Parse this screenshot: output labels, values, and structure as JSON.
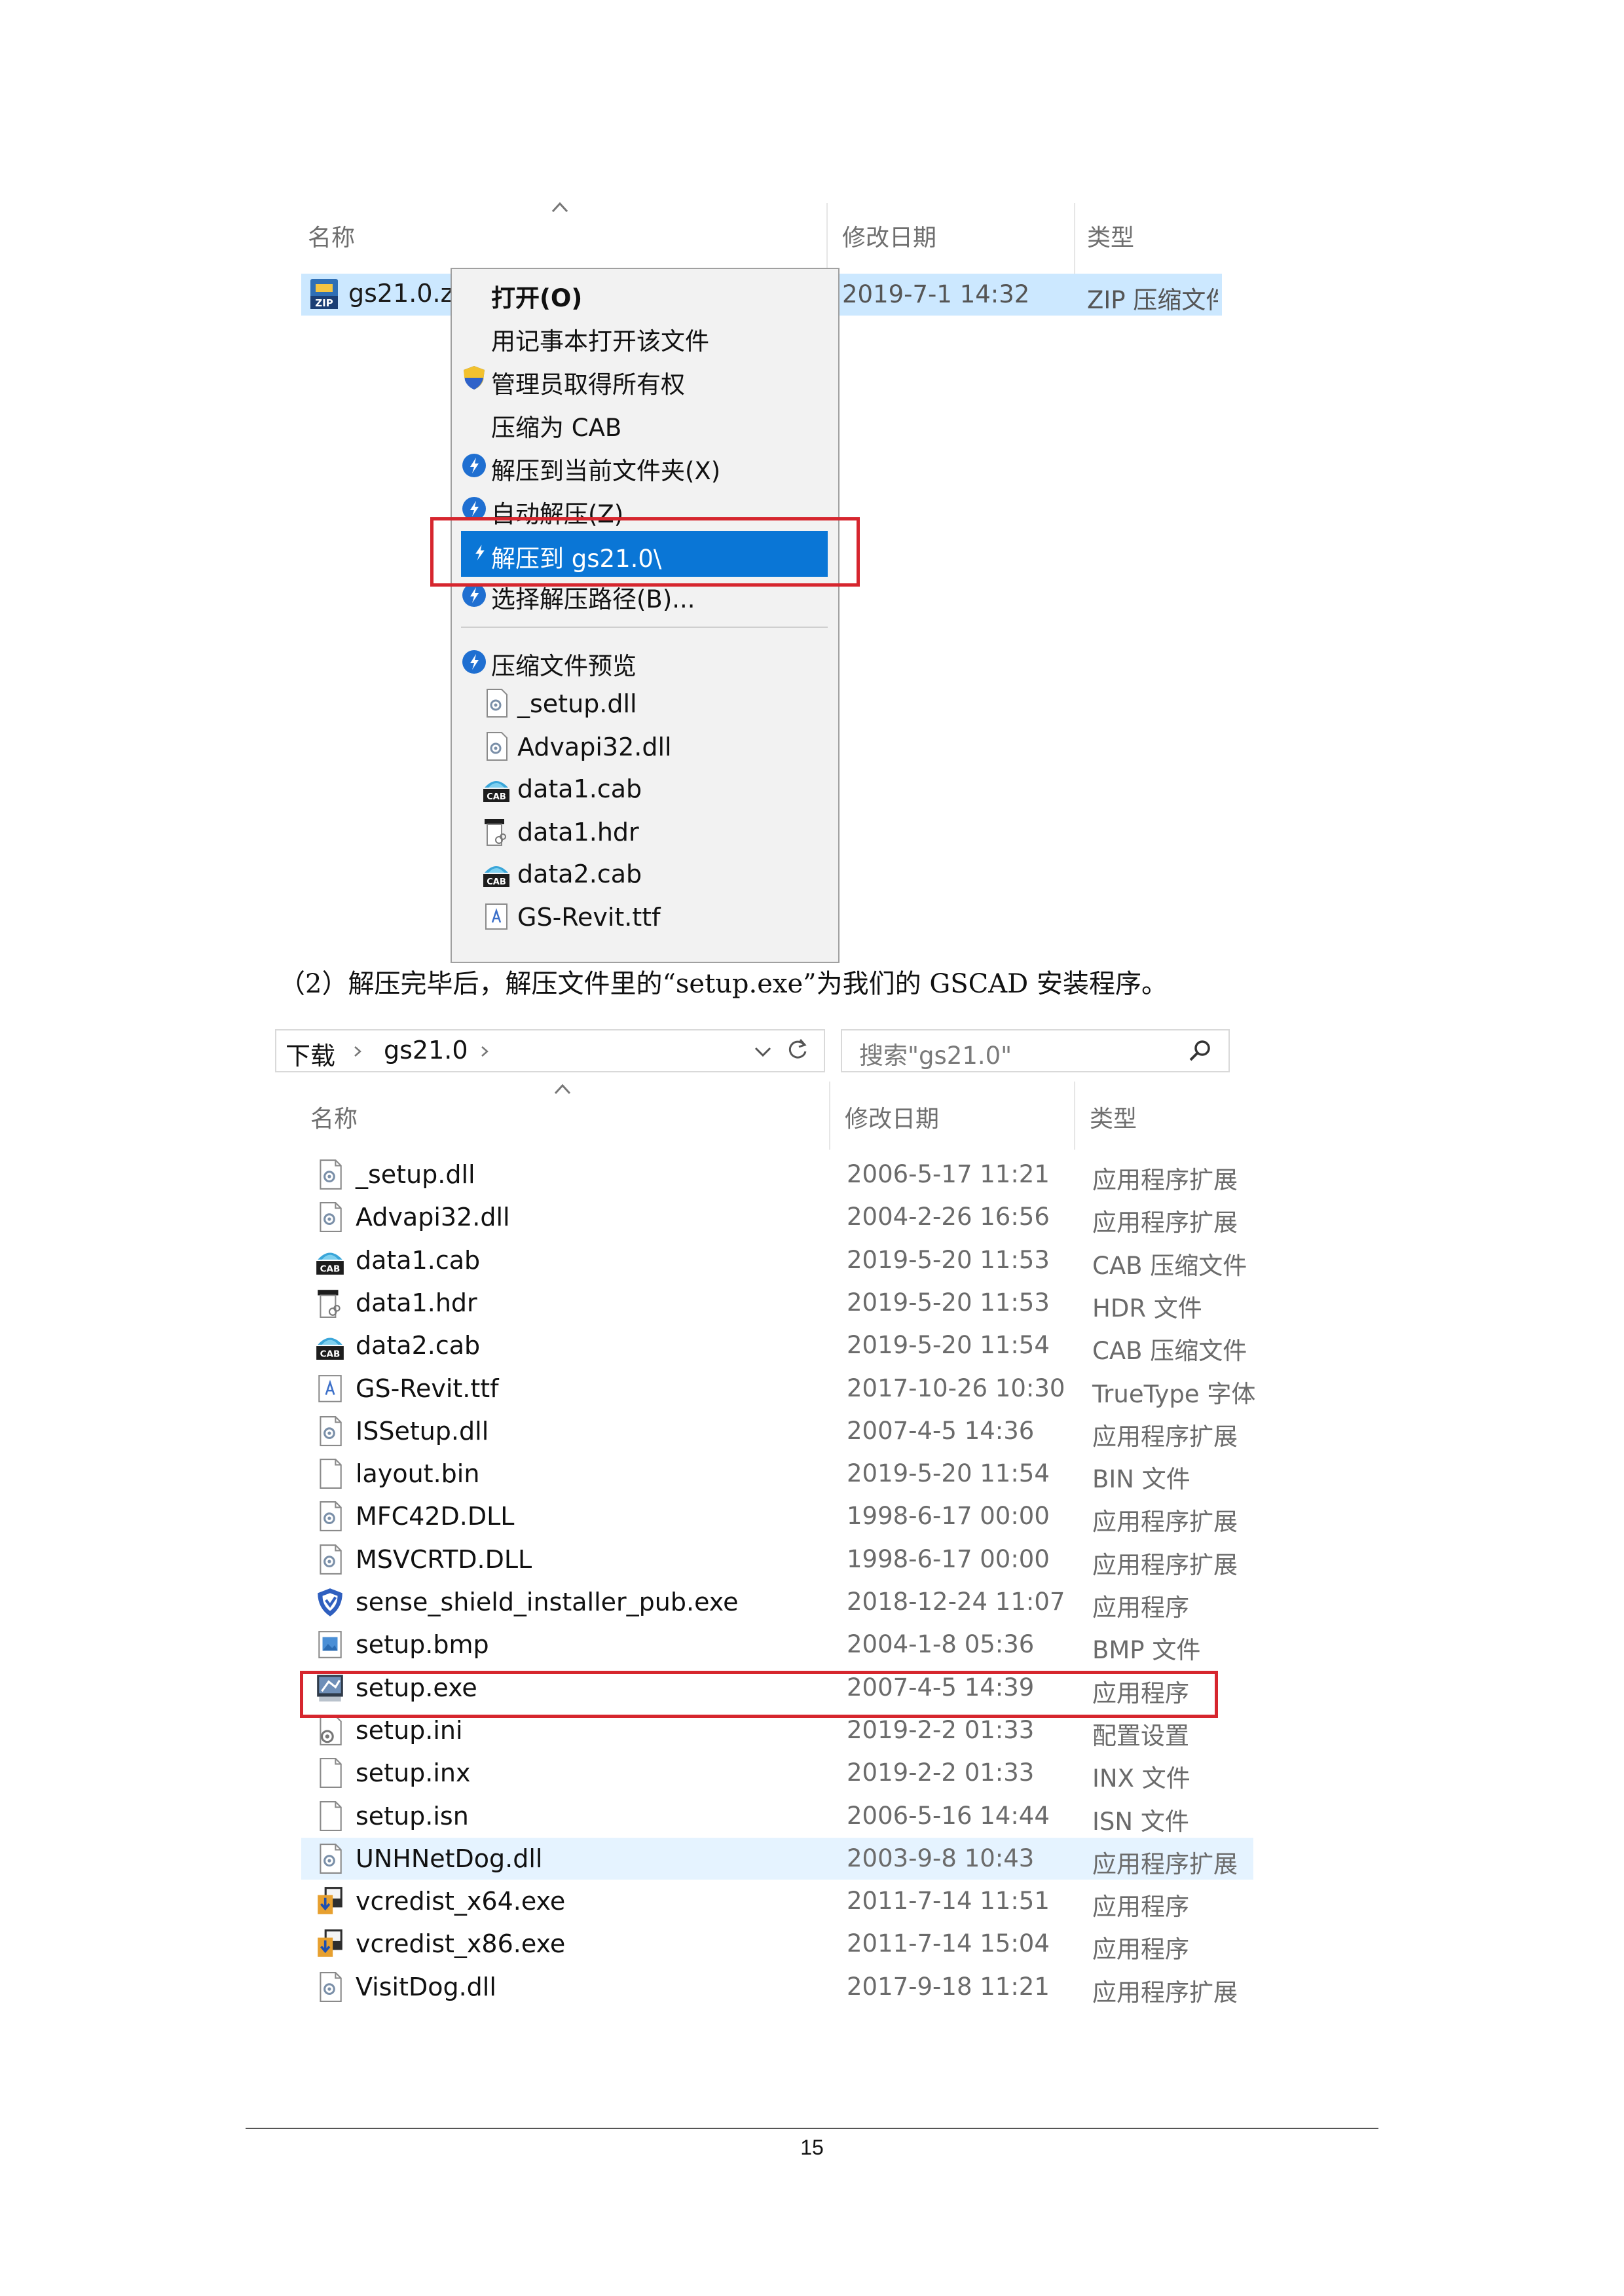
{
  "explorer_top": {
    "columns": {
      "name": "名称",
      "modified": "修改日期",
      "type": "类型"
    },
    "selected_file": {
      "name": "gs21.0.z",
      "date": "2019-7-1 14:32",
      "type": "ZIP 压缩文件"
    }
  },
  "context_menu": {
    "items": [
      {
        "label": "打开(O)",
        "bold": true,
        "icon": "none"
      },
      {
        "label": "用记事本打开该文件",
        "icon": "none"
      },
      {
        "label": "管理员取得所有权",
        "icon": "shield-icon"
      },
      {
        "label": "压缩为 CAB",
        "icon": "none"
      },
      {
        "label": "解压到当前文件夹(X)",
        "icon": "bandizip-icon"
      },
      {
        "label": "自动解压(Z)",
        "icon": "bandizip-icon"
      },
      {
        "label": "解压到 gs21.0\\",
        "icon": "bandizip-icon",
        "highlighted": true
      },
      {
        "label": "选择解压路径(B)...",
        "icon": "bandizip-icon"
      }
    ],
    "preview_header": "压缩文件预览",
    "preview_files": [
      {
        "name": "_setup.dll",
        "icon": "dll-icon"
      },
      {
        "name": "Advapi32.dll",
        "icon": "dll-icon"
      },
      {
        "name": "data1.cab",
        "icon": "cab-icon"
      },
      {
        "name": "data1.hdr",
        "icon": "hdr-icon"
      },
      {
        "name": "data2.cab",
        "icon": "cab-icon"
      },
      {
        "name": "GS-Revit.ttf",
        "icon": "font-icon"
      }
    ]
  },
  "caption": "（2）解压完毕后，解压文件里的“setup.exe”为我们的 GSCAD 安装程序。",
  "explorer_bottom": {
    "breadcrumb": [
      "下载",
      "gs21.0"
    ],
    "search_placeholder": "搜索\"gs21.0\"",
    "columns": {
      "name": "名称",
      "modified": "修改日期",
      "type": "类型"
    },
    "files": [
      {
        "name": "_setup.dll",
        "date": "2006-5-17 11:21",
        "type": "应用程序扩展",
        "icon": "dll-icon"
      },
      {
        "name": "Advapi32.dll",
        "date": "2004-2-26 16:56",
        "type": "应用程序扩展",
        "icon": "dll-icon"
      },
      {
        "name": "data1.cab",
        "date": "2019-5-20 11:53",
        "type": "CAB 压缩文件",
        "icon": "cab-icon"
      },
      {
        "name": "data1.hdr",
        "date": "2019-5-20 11:53",
        "type": "HDR 文件",
        "icon": "hdr-icon"
      },
      {
        "name": "data2.cab",
        "date": "2019-5-20 11:54",
        "type": "CAB 压缩文件",
        "icon": "cab-icon"
      },
      {
        "name": "GS-Revit.ttf",
        "date": "2017-10-26 10:30",
        "type": "TrueType 字体",
        "icon": "font-icon"
      },
      {
        "name": "ISSetup.dll",
        "date": "2007-4-5 14:36",
        "type": "应用程序扩展",
        "icon": "dll-icon"
      },
      {
        "name": "layout.bin",
        "date": "2019-5-20 11:54",
        "type": "BIN 文件",
        "icon": "blank-file-icon"
      },
      {
        "name": "MFC42D.DLL",
        "date": "1998-6-17 00:00",
        "type": "应用程序扩展",
        "icon": "dll-icon"
      },
      {
        "name": "MSVCRTD.DLL",
        "date": "1998-6-17 00:00",
        "type": "应用程序扩展",
        "icon": "dll-icon"
      },
      {
        "name": "sense_shield_installer_pub.exe",
        "date": "2018-12-24 11:07",
        "type": "应用程序",
        "icon": "shield-app-icon"
      },
      {
        "name": "setup.bmp",
        "date": "2004-1-8 05:36",
        "type": "BMP 文件",
        "icon": "image-file-icon"
      },
      {
        "name": "setup.exe",
        "date": "2007-4-5 14:39",
        "type": "应用程序",
        "icon": "setup-exe-icon",
        "highlighted": true
      },
      {
        "name": "setup.ini",
        "date": "2019-2-2 01:33",
        "type": "配置设置",
        "icon": "ini-icon"
      },
      {
        "name": "setup.inx",
        "date": "2019-2-2 01:33",
        "type": "INX 文件",
        "icon": "blank-file-icon"
      },
      {
        "name": "setup.isn",
        "date": "2006-5-16 14:44",
        "type": "ISN 文件",
        "icon": "blank-file-icon"
      },
      {
        "name": "UNHNetDog.dll",
        "date": "2003-9-8 10:43",
        "type": "应用程序扩展",
        "icon": "dll-icon",
        "hovered": true
      },
      {
        "name": "vcredist_x64.exe",
        "date": "2011-7-14 11:51",
        "type": "应用程序",
        "icon": "installer-icon"
      },
      {
        "name": "vcredist_x86.exe",
        "date": "2011-7-14 15:04",
        "type": "应用程序",
        "icon": "installer-icon"
      },
      {
        "name": "VisitDog.dll",
        "date": "2017-9-18 11:21",
        "type": "应用程序扩展",
        "icon": "dll-icon"
      }
    ]
  },
  "page_number": "15",
  "colors": {
    "menu_highlight": "#0a76d6",
    "red_box": "#d6262e",
    "selection": "#cce8ff",
    "hover": "#e5f3ff"
  }
}
